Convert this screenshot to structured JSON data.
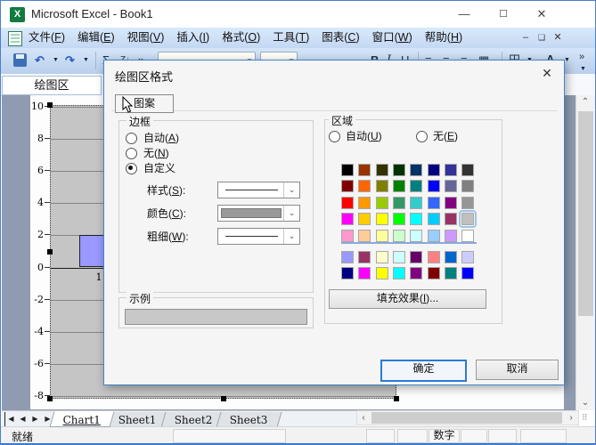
{
  "window": {
    "title": "Microsoft Excel - Book1"
  },
  "menu": {
    "items": [
      "文件(F)",
      "编辑(E)",
      "视图(V)",
      "插入(I)",
      "格式(O)",
      "工具(T)",
      "图表(C)",
      "窗口(W)",
      "帮助(H)"
    ]
  },
  "name_box": {
    "value": "绘图区"
  },
  "dialog": {
    "title": "绘图区格式",
    "tab": "图案",
    "border": {
      "label": "边框",
      "auto": "自动(A)",
      "none": "无(N)",
      "custom": "自定义",
      "selected": "custom",
      "style_label": "样式(S):",
      "color_label": "颜色(C):",
      "weight_label": "粗细(W):",
      "color_value": "#999999"
    },
    "sample": {
      "label": "示例",
      "fill": "#c8c8c8"
    },
    "area": {
      "label": "区域",
      "auto": "自动(U)",
      "none": "无(E)",
      "fill_effects": "填充效果(I)...",
      "selected_color": "#C0C0C0",
      "selected_cell": {
        "row": 3,
        "col": 7
      },
      "palette": [
        [
          "#000000",
          "#993300",
          "#333300",
          "#003300",
          "#003366",
          "#000080",
          "#333399",
          "#333333"
        ],
        [
          "#800000",
          "#FF6600",
          "#808000",
          "#008000",
          "#008080",
          "#0000FF",
          "#666699",
          "#808080"
        ],
        [
          "#FF0000",
          "#FF9900",
          "#99CC00",
          "#339966",
          "#33CCCC",
          "#3366FF",
          "#800080",
          "#969696"
        ],
        [
          "#FF00FF",
          "#FFCC00",
          "#FFFF00",
          "#00FF00",
          "#00FFFF",
          "#00CCFF",
          "#993366",
          "#C0C0C0"
        ],
        [
          "#FF99CC",
          "#FFCC99",
          "#FFFF99",
          "#CCFFCC",
          "#CCFFFF",
          "#99CCFF",
          "#CC99FF",
          "#FFFFFF"
        ],
        [
          "#9999FF",
          "#993366",
          "#FFFFCC",
          "#CCFFFF",
          "#660066",
          "#FF8080",
          "#0066CC",
          "#CCCCFF"
        ],
        [
          "#000080",
          "#FF00FF",
          "#FFFF00",
          "#00FFFF",
          "#800080",
          "#800000",
          "#008080",
          "#0000FF"
        ]
      ]
    },
    "ok": "确定",
    "cancel": "取消"
  },
  "chart_data": {
    "type": "bar",
    "categories": [
      "1"
    ],
    "values": [
      2
    ],
    "y_ticks": [
      10,
      8,
      6,
      4,
      2,
      0,
      -2,
      -4,
      -6,
      -8
    ],
    "ylim": [
      -8,
      10
    ],
    "bar_color": "#9999FF",
    "plot_fill": "#C0C0C0",
    "grid": true
  },
  "sheet_tabs": {
    "items": [
      {
        "label": "Chart1",
        "active": true
      },
      {
        "label": "Sheet1",
        "active": false
      },
      {
        "label": "Sheet2",
        "active": false
      },
      {
        "label": "Sheet3",
        "active": false
      }
    ]
  },
  "status": {
    "ready": "就绪",
    "num": "数字"
  }
}
